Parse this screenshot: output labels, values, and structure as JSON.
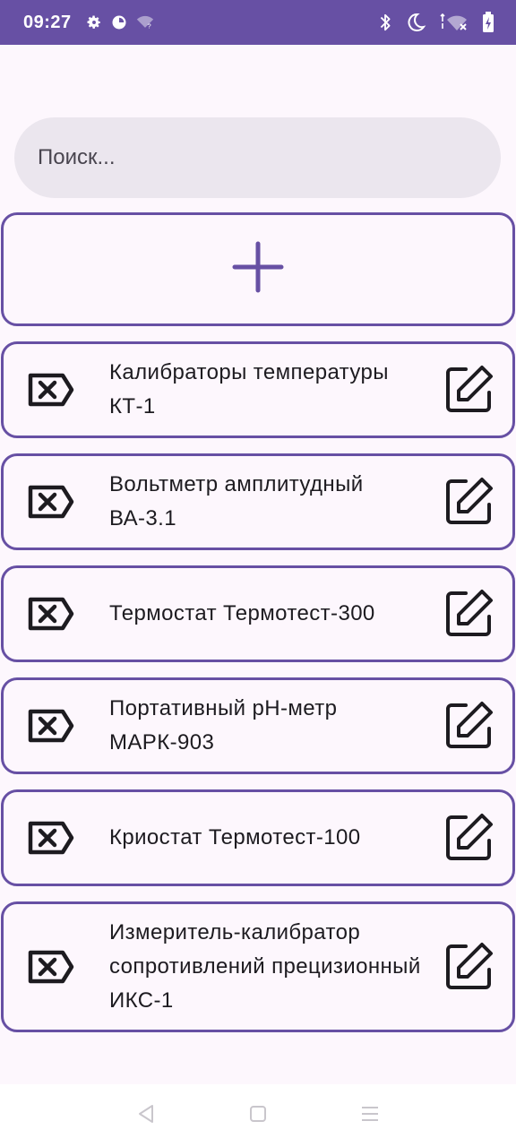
{
  "status_bar": {
    "time": "09:27",
    "background": "#6750a4",
    "left_icons": [
      "settings-icon",
      "data-saver-icon",
      "wifi-unknown-icon"
    ],
    "right_icons": [
      "bluetooth-icon",
      "do-not-disturb-icon",
      "wifi-off-icon",
      "battery-icon"
    ]
  },
  "search": {
    "placeholder": "Поиск...",
    "value": ""
  },
  "add_button": {
    "icon": "plus-icon",
    "color": "#6750a4"
  },
  "items": [
    {
      "title": "Калибраторы температуры КТ-1"
    },
    {
      "title": "Вольтметр амплитудный ВА-3.1"
    },
    {
      "title": "Термостат Термотест-300"
    },
    {
      "title": "Портативный pH-метр МАРК-903"
    },
    {
      "title": "Криостат Термотест-100"
    },
    {
      "title": "Измеритель-калибратор сопротивлений прецизионный ИКС-1"
    }
  ],
  "item_icons": {
    "delete": "backspace-delete-icon",
    "edit": "edit-pencil-icon"
  },
  "nav_bar": [
    "back-icon",
    "home-icon",
    "menu-icon"
  ],
  "colors": {
    "accent": "#6750a4",
    "background": "#fdf7fd",
    "search_background": "#ebe6ee"
  }
}
